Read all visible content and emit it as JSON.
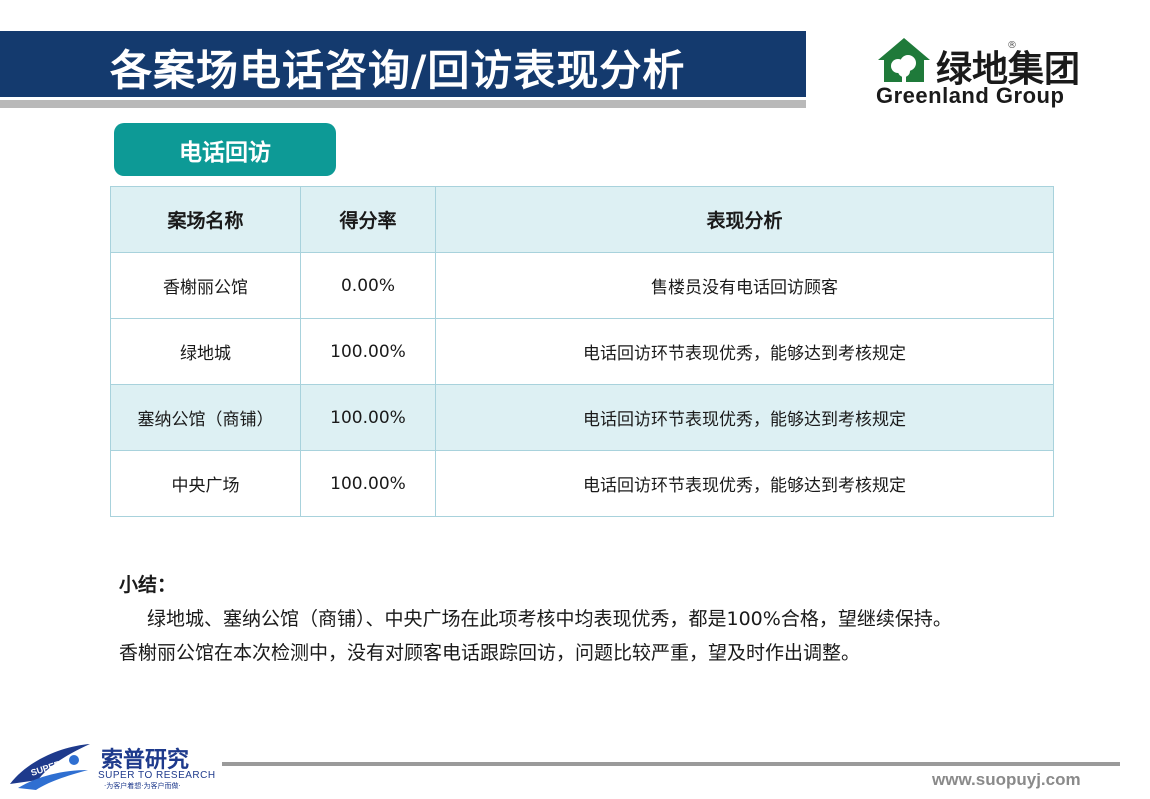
{
  "header": {
    "title": "各案场电话咨询/回访表现分析"
  },
  "logo": {
    "cn": "绿地集团",
    "reg": "®",
    "en": "Greenland Group"
  },
  "section_tag": "电话回访",
  "table": {
    "headers": [
      "案场名称",
      "得分率",
      "表现分析"
    ],
    "rows": [
      [
        "香榭丽公馆",
        "0.00%",
        "售楼员没有电话回访顾客"
      ],
      [
        "绿地城",
        "100.00%",
        "电话回访环节表现优秀，能够达到考核规定"
      ],
      [
        "塞纳公馆（商铺）",
        "100.00%",
        "电话回访环节表现优秀，能够达到考核规定"
      ],
      [
        "中央广场",
        "100.00%",
        "电话回访环节表现优秀，能够达到考核规定"
      ]
    ]
  },
  "summary": {
    "title": "小结：",
    "para1": "绿地城、塞纳公馆（商铺）、中央广场在此项考核中均表现优秀，都是100%合格，望继续保持。",
    "para2": "香榭丽公馆在本次检测中，没有对顾客电话跟踪回访，问题比较严重，望及时作出调整。"
  },
  "footer": {
    "brand_cn": "索普研究",
    "brand_en": "SUPER TO RESEARCH",
    "brand_sub": "·为客户着想·为客户而做·",
    "swoosh_text": "SUPER",
    "url": "www.suopuyj.com"
  },
  "colors": {
    "title_bar": "#143a6e",
    "section_tag": "#0d9a96",
    "header_row": "#ddf0f3",
    "logo_green": "#1f7a3a",
    "footer_blue": "#1e3a8c"
  }
}
